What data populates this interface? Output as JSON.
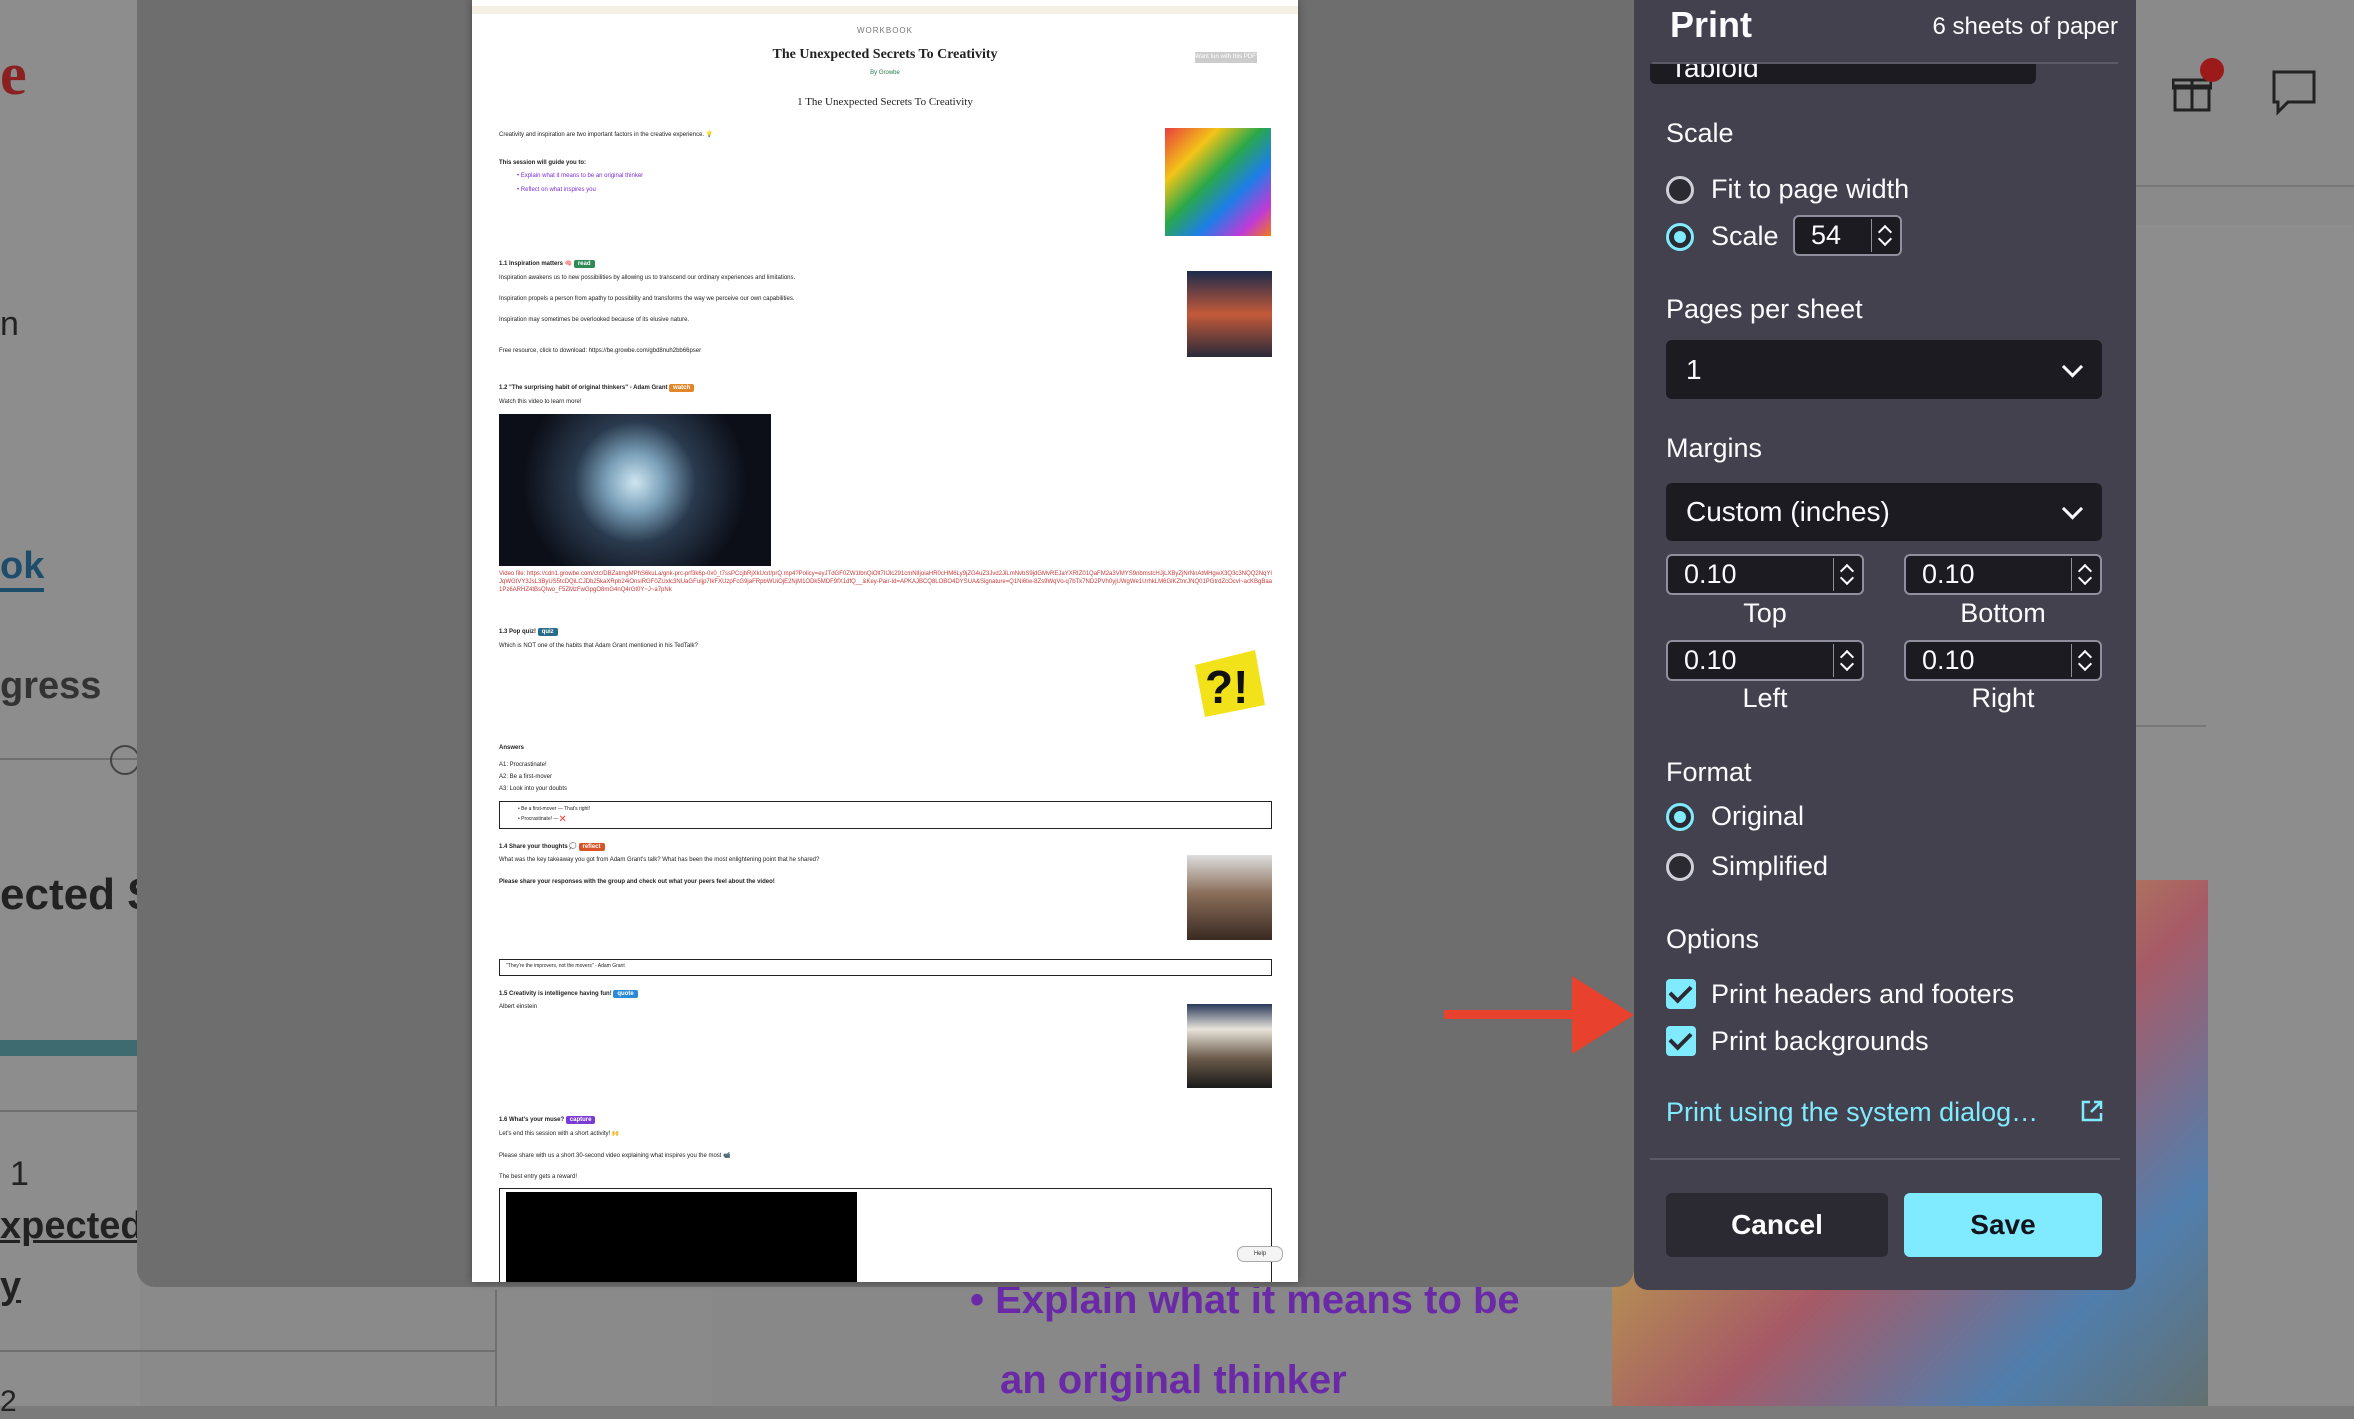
{
  "background_page": {
    "fragments": [
      "e",
      "n",
      "ok",
      "gress",
      "ected S",
      "1",
      "xpected",
      "y",
      "y",
      "2"
    ],
    "bullet_line1": "Explain what it means to be",
    "bullet_line2": "an original thinker"
  },
  "preview": {
    "kicker": "WORKBOOK",
    "title": "The Unexpected Secrets To Creativity",
    "byline": "By Growbe",
    "badge": "Want fun with this PDF?",
    "section_heading": "1 The Unexpected Secrets To Creativity",
    "intro": "Creativity and inspiration are two important factors in the creative experience. 💡",
    "guide_heading": "This session will guide you to:",
    "guide_items": [
      "Explain what it means to be an original thinker",
      "Reflect on what inspires you"
    ],
    "s11": {
      "heading": "1.1 Inspiration matters 🧠",
      "tag": "read",
      "lines": [
        "Inspiration awakens us to new possibilities by allowing us to transcend our ordinary experiences and limitations.",
        "Inspiration propels a person from apathy to possibility and transforms the way we perceive our own capabilities.",
        "Inspiration may sometimes be overlooked because of its elusive nature.",
        "Free resource, click to download: https://be.growbe.com/gbd8nuh2bb66pser"
      ]
    },
    "s12": {
      "heading": "1.2 \"The surprising habit of original thinkers\" - Adam Grant",
      "tag": "watch",
      "sub": "Watch this video to learn more!",
      "video_file": "Video file: https://cdn1.growbe.com/ctc/DBZatmgMPhS6kuLa/gnk-prc-prf3k6p-0x0_t7ssPCcjbRjXkUcrl/prQ.mp4?Policy=eyJTdGF0ZW1lbnQiOlt7IlJlc291cmNlIjoiaHR0cHM6Ly9jZG4uZ3Jvd2JlLmNvbS9jdGMvREJaYXRtZ01QaFM2a3VMYS9nbmstcHJjLXByZjNrNnAtMHgwX3Q3c3NQQ2NqYlJqWGtVY3JsL3ByUS5tcDQiLCJDb25kaXRpb24iOnsiRGF0ZUxlc3NUaGFuIjp7IkFXUzpFcG9jaFRpbWUiOjE2NjM1ODk5MDF9fX1dfQ__&Key-Pair-Id=APKAJBCQ8LOBO4DYSUA&Signature=Q1Ni6tw-8Zs9WqVo-q7bTk7ND2PVh0yjUWgWe1UrhkLM6GlKZtnrJNQ01PGtrdZcOcvl~acKBgBaa1Pz6ARHZ4tBsQIwo_F5ZMzFwGpgO8mG4nQ4rGt0Y~J~a7pNk"
    },
    "s13": {
      "heading": "1.3 Pop quiz!",
      "tag": "quiz",
      "question": "Which is NOT one of the habits that Adam Grant mentioned in his TedTalk?"
    },
    "answers": {
      "heading": "Answers",
      "a1": "A1: Procrastinate!",
      "a2": "A2: Be a first-mover",
      "a3": "A3: Look into your doubts",
      "box1": "Be a first-mover — That's right!",
      "box2": "Procrastinate! — ❌"
    },
    "s14": {
      "heading": "1.4 Share your thoughts 💭",
      "tag": "reflect",
      "q": "What was the key takeaway you got from Adam Grant's talk? What has been the most enlightening point that he shared?",
      "instr": "Please share your responses with the group and check out what your peers feel about the video!",
      "quote": "\"They're the improvers, not the movers\" - Adam Grant"
    },
    "s15": {
      "heading": "1.5 Creativity is intelligence having fun!",
      "tag": "quote",
      "sub": "Albert einstein"
    },
    "s16": {
      "heading": "1.6 What's your muse?",
      "tag": "capture",
      "l1": "Let's end this session with a short activity! 🙌",
      "l2": "Please share with us a short 30-second video explaining what inspires you the most 📹",
      "l3": "The best entry gets a reward!"
    },
    "help": "Help"
  },
  "panel": {
    "title": "Print",
    "sheets": "6 sheets of paper",
    "paper_size_partial": "Tabloid",
    "scale": {
      "label": "Scale",
      "fit_label": "Fit to page width",
      "scale_label": "Scale",
      "value": "54",
      "selected": "scale"
    },
    "pages_per_sheet": {
      "label": "Pages per sheet",
      "value": "1"
    },
    "margins": {
      "label": "Margins",
      "value": "Custom (inches)",
      "top": "0.10",
      "bottom": "0.10",
      "left": "0.10",
      "right": "0.10",
      "top_label": "Top",
      "bottom_label": "Bottom",
      "left_label": "Left",
      "right_label": "Right"
    },
    "format": {
      "label": "Format",
      "original": "Original",
      "simplified": "Simplified",
      "selected": "original"
    },
    "options": {
      "label": "Options",
      "headers": "Print headers and footers",
      "backgrounds": "Print backgrounds",
      "headers_checked": true,
      "backgrounds_checked": true
    },
    "system_dialog": "Print using the system dialog…",
    "cancel": "Cancel",
    "save": "Save",
    "accent": "#80ebff"
  },
  "annotation": {
    "arrow_color": "#e8412e"
  }
}
